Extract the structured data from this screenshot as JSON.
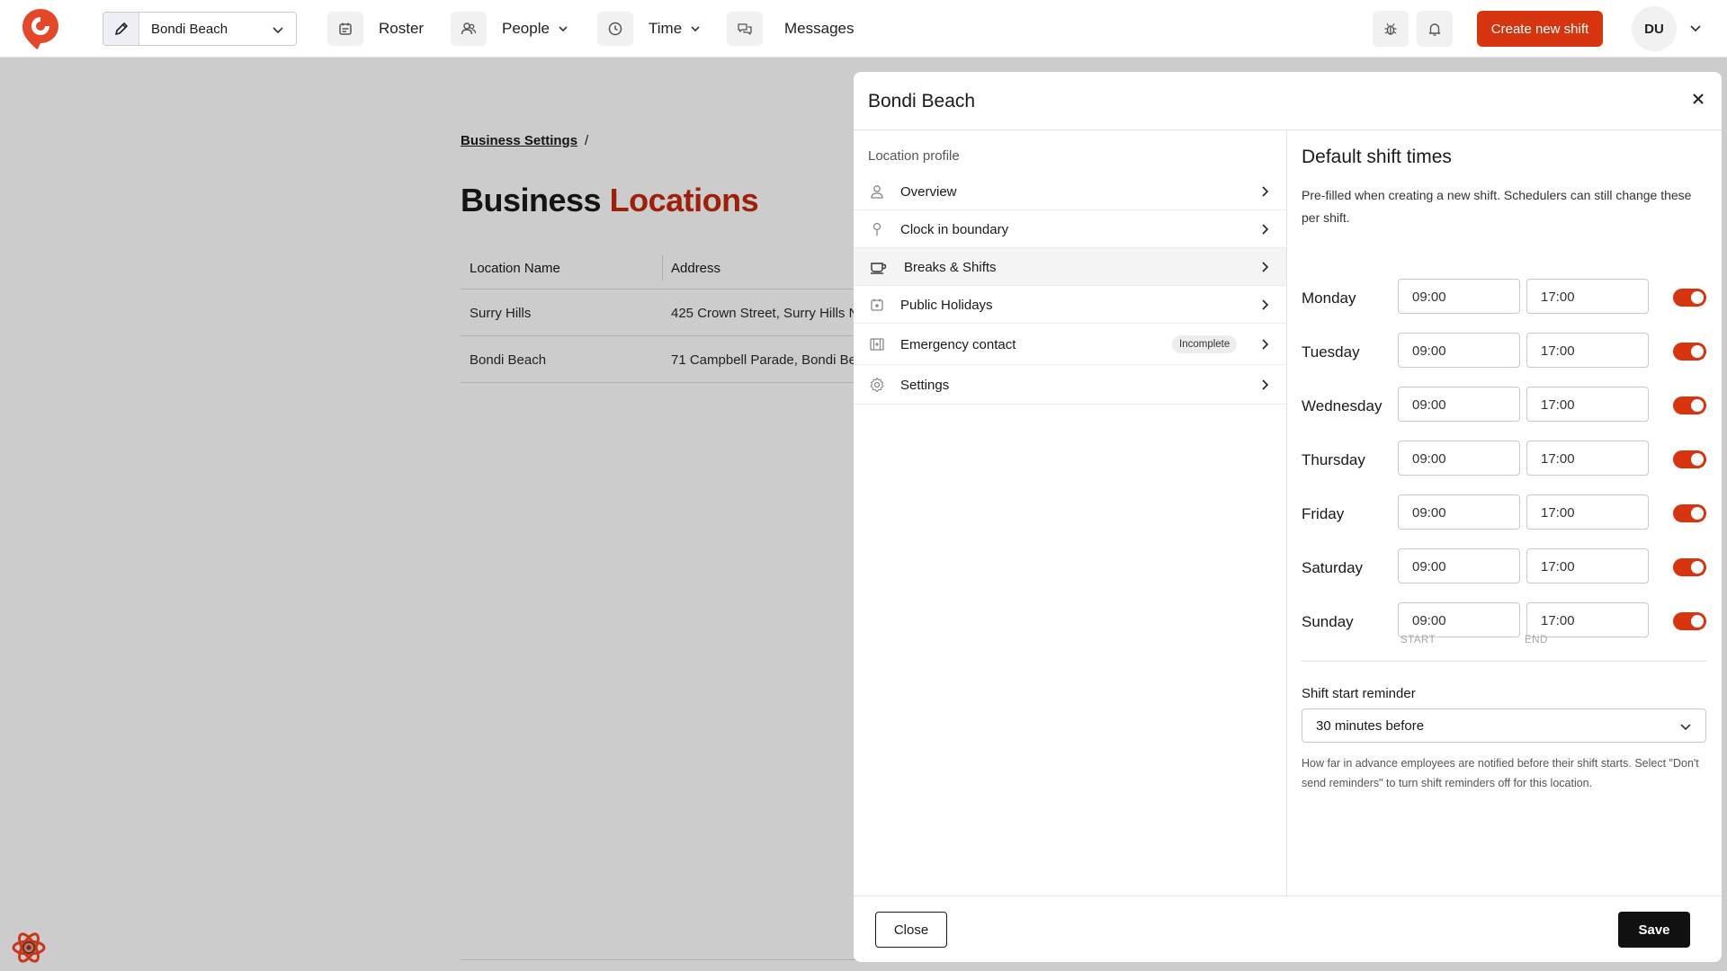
{
  "colors": {
    "accent": "#d7350f",
    "title_accent": "#c3290d",
    "save": "#111111",
    "overlay": "rgba(0,0,0,0.2)"
  },
  "topbar": {
    "logo_icon": "brand-logo-icon",
    "location_selector": {
      "value": "Bondi Beach",
      "edit_icon": "pencil-icon",
      "chevron": "chevron-down-icon"
    },
    "nav": [
      {
        "label": "Roster",
        "icon": "calendar-icon"
      },
      {
        "label": "People",
        "icon": "users-icon",
        "dropdown": true
      },
      {
        "label": "Time",
        "icon": "clock-icon",
        "dropdown": true
      },
      {
        "label": "Messages",
        "icon": "chat-icon"
      }
    ],
    "bug_icon": "bug-icon",
    "bell_icon": "bell-icon",
    "create_button": "Create new shift",
    "avatar_initials": "DU"
  },
  "page": {
    "breadcrumb": {
      "link": "Business Settings",
      "separator": "/"
    },
    "title_main": "Business",
    "title_accent": "Locations",
    "table": {
      "headers": [
        "Location Name",
        "Address"
      ],
      "rows": [
        [
          "Surry Hills",
          "425 Crown Street, Surry Hills N"
        ],
        [
          "Bondi Beach",
          "71 Campbell Parade, Bondi Be"
        ]
      ]
    },
    "debug_icon": "react-atom-icon"
  },
  "modal": {
    "title": "Bondi Beach",
    "close_icon": "close-icon",
    "section_label": "Location profile",
    "menu": [
      {
        "label": "Overview",
        "icon": "person-icon"
      },
      {
        "label": "Clock in boundary",
        "icon": "pin-icon"
      },
      {
        "label": "Breaks & Shifts",
        "icon": "coffee-cup-icon",
        "active": true
      },
      {
        "label": "Public Holidays",
        "icon": "calendar-star-icon"
      },
      {
        "label": "Emergency contact",
        "icon": "medical-kit-icon",
        "badge": "Incomplete"
      },
      {
        "label": "Settings",
        "icon": "gear-icon"
      }
    ],
    "shift_times": {
      "title": "Default shift times",
      "description": "Pre-filled when creating a new shift. Schedulers can still change these per shift.",
      "days": [
        {
          "name": "Monday",
          "start": "09:00",
          "end": "17:00",
          "enabled": true
        },
        {
          "name": "Tuesday",
          "start": "09:00",
          "end": "17:00",
          "enabled": true
        },
        {
          "name": "Wednesday",
          "start": "09:00",
          "end": "17:00",
          "enabled": true
        },
        {
          "name": "Thursday",
          "start": "09:00",
          "end": "17:00",
          "enabled": true
        },
        {
          "name": "Friday",
          "start": "09:00",
          "end": "17:00",
          "enabled": true
        },
        {
          "name": "Saturday",
          "start": "09:00",
          "end": "17:00",
          "enabled": true
        },
        {
          "name": "Sunday",
          "start": "09:00",
          "end": "17:00",
          "enabled": true
        }
      ],
      "start_label": "START",
      "end_label": "END"
    },
    "reminder": {
      "label": "Shift start reminder",
      "value": "30 minutes before",
      "help": "How far in advance employees are notified before their shift starts. Select \"Don't send reminders\" to turn shift reminders off for this location."
    },
    "footer": {
      "close": "Close",
      "save": "Save"
    }
  }
}
